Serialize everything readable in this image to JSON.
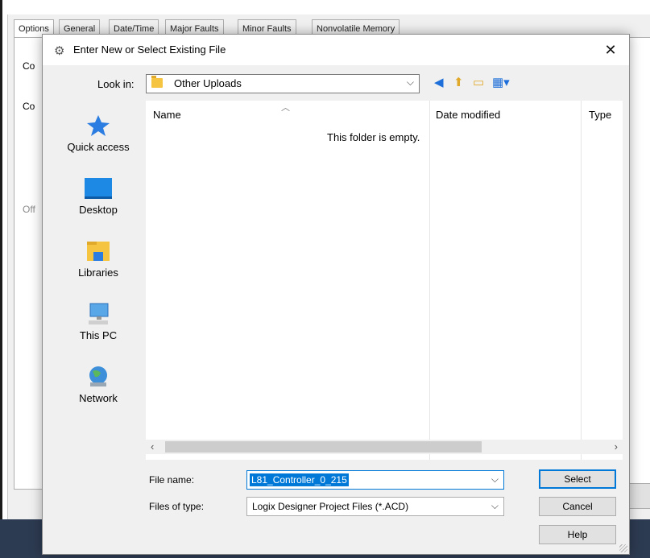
{
  "background": {
    "tabs": [
      "Options",
      "General",
      "Date/Time",
      "Major Faults",
      "Minor Faults",
      "Nonvolatile Memory"
    ],
    "fragments": [
      "Co",
      "Co",
      "Off"
    ]
  },
  "dialog": {
    "title": "Enter New or Select Existing File",
    "title_icon": "gear-document-icon",
    "close_label": "✕",
    "look_in": {
      "label": "Look in:",
      "value": "Other Uploads"
    },
    "toolbar": [
      "back-icon",
      "up-folder-icon",
      "new-folder-icon",
      "view-menu-icon"
    ],
    "places": [
      {
        "label": "Quick access",
        "icon": "star-icon"
      },
      {
        "label": "Desktop",
        "icon": "desktop-icon"
      },
      {
        "label": "Libraries",
        "icon": "libraries-icon"
      },
      {
        "label": "This PC",
        "icon": "computer-icon"
      },
      {
        "label": "Network",
        "icon": "network-icon"
      }
    ],
    "columns": {
      "name": "Name",
      "date_modified": "Date modified",
      "type": "Type"
    },
    "empty_message": "This folder is empty.",
    "file_name": {
      "label": "File name:",
      "value": "L81_Controller_0_215"
    },
    "file_type": {
      "label": "Files of type:",
      "value": "Logix Designer Project Files (*.ACD)"
    },
    "buttons": {
      "select": "Select",
      "cancel": "Cancel",
      "help": "Help"
    }
  }
}
